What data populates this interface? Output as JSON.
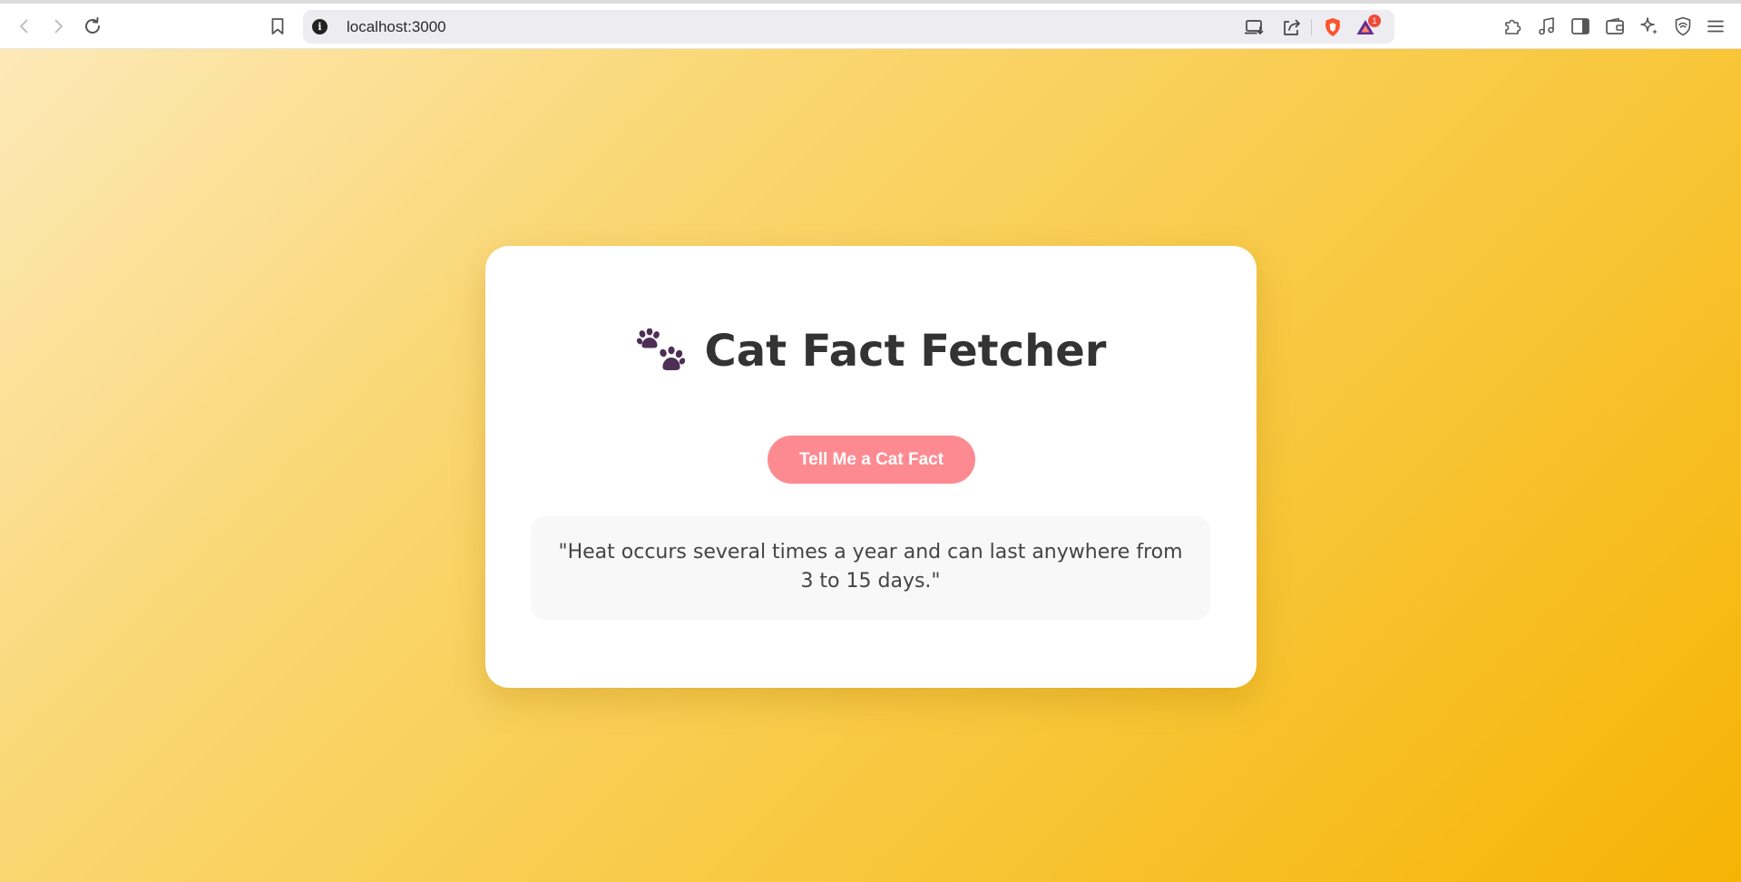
{
  "browser": {
    "url": "localhost:3000",
    "extension_badge": "1",
    "icons": {
      "back": "back-arrow-icon",
      "forward": "forward-arrow-icon",
      "reload": "reload-icon",
      "bookmark": "bookmark-icon",
      "site_info": "info-icon",
      "install": "install-app-icon",
      "share": "share-icon",
      "shields": "brave-shields-icon",
      "rewards": "brave-rewards-icon",
      "extensions": "puzzle-icon",
      "media": "music-note-icon",
      "sidebar": "sidebar-icon",
      "wallet": "wallet-icon",
      "leo": "sparkle-icon",
      "vpn": "vpn-shield-icon",
      "menu": "hamburger-menu-icon"
    }
  },
  "page": {
    "title": "Cat Fact Fetcher",
    "title_icon": "paw-prints-icon",
    "button_label": "Tell Me a Cat Fact",
    "fact_text": "\"Heat occurs several times a year and can last anywhere from 3 to 15 days.\"",
    "colors": {
      "button": "#fe8a91",
      "background_start": "#fde9b8",
      "background_end": "#f6b304",
      "card": "#ffffff",
      "fact_box": "#f8f8f8",
      "title_text": "#333333"
    }
  }
}
